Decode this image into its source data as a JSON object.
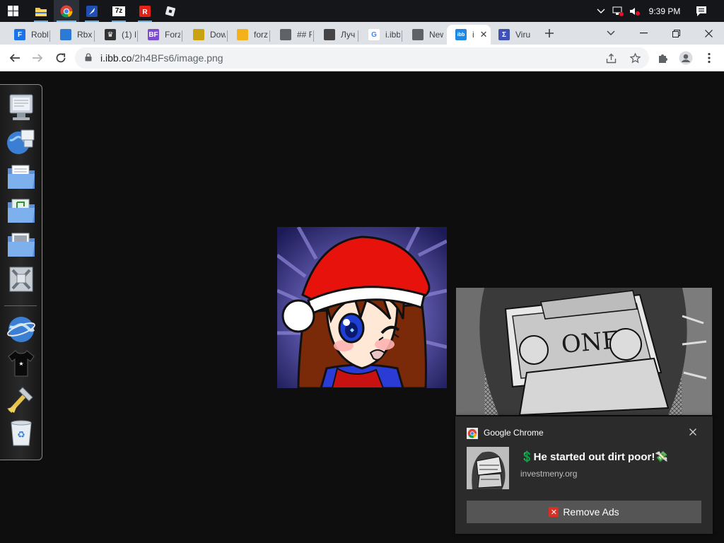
{
  "taskbar": {
    "apps": [
      {
        "name": "start-button",
        "icon": "windows-logo-icon"
      },
      {
        "name": "file-explorer",
        "icon": "folder-icon"
      },
      {
        "name": "chrome",
        "icon": "chrome-icon"
      },
      {
        "name": "app-blue",
        "icon": "feather-icon"
      },
      {
        "name": "7zip",
        "icon": "7zip-icon",
        "label": "7z"
      },
      {
        "name": "roblox",
        "icon": "roblox-icon"
      },
      {
        "name": "roblox-studio",
        "icon": "roblox-studio-icon"
      }
    ],
    "clock": "9:39 PM",
    "colors": {
      "bg": "#14161a",
      "active": "#76b9ed"
    }
  },
  "tabs": [
    {
      "title": "Robl",
      "icon": "f-logo-icon",
      "color": "#1a73e8",
      "glyph": "F"
    },
    {
      "title": "Rbx",
      "icon": "rbx-icon",
      "color": "#2d7ad6",
      "glyph": ""
    },
    {
      "title": "(1) N",
      "icon": "crown-icon",
      "color": "#333333",
      "glyph": "♛"
    },
    {
      "title": "Forz",
      "icon": "bf-icon",
      "color": "#7b4ccf",
      "glyph": "BF"
    },
    {
      "title": "Dow",
      "icon": "banana-icon",
      "color": "#caa10f",
      "glyph": ""
    },
    {
      "title": "forz",
      "icon": "folder-icon",
      "color": "#f3b21b",
      "glyph": ""
    },
    {
      "title": "## F",
      "icon": "globe-icon",
      "color": "#5f6368",
      "glyph": ""
    },
    {
      "title": "Луч",
      "icon": "cube-icon",
      "color": "#444444",
      "glyph": ""
    },
    {
      "title": "i.ibb",
      "icon": "google-icon",
      "color": "#ffffff",
      "glyph": "G"
    },
    {
      "title": "New",
      "icon": "chrome-icon",
      "color": "#5f6368",
      "glyph": ""
    },
    {
      "title": "i",
      "icon": "ibb-icon",
      "color": "#1e88e5",
      "glyph": "ibb"
    },
    {
      "title": "Viru",
      "icon": "virustotal-icon",
      "color": "#3f51b5",
      "glyph": "Σ"
    }
  ],
  "address_bar": {
    "host": "i.ibb.co",
    "path": "/2h4BFs6/image.png"
  },
  "notification": {
    "app_name": "Google Chrome",
    "title": "💲He started out dirt poor!💸",
    "site": "investmeny.org",
    "action_label": "Remove Ads",
    "colors": {
      "bg": "#2b2b2b",
      "button": "#555555"
    }
  },
  "dock": {
    "items": [
      "computer-icon",
      "network-globe-icon",
      "documents-folder-icon",
      "music-folder-icon",
      "pictures-folder-icon",
      "tools-icon",
      "internet-globe-icon",
      "tshirt-icon",
      "hammer-icon",
      "recycle-bin-icon"
    ]
  }
}
